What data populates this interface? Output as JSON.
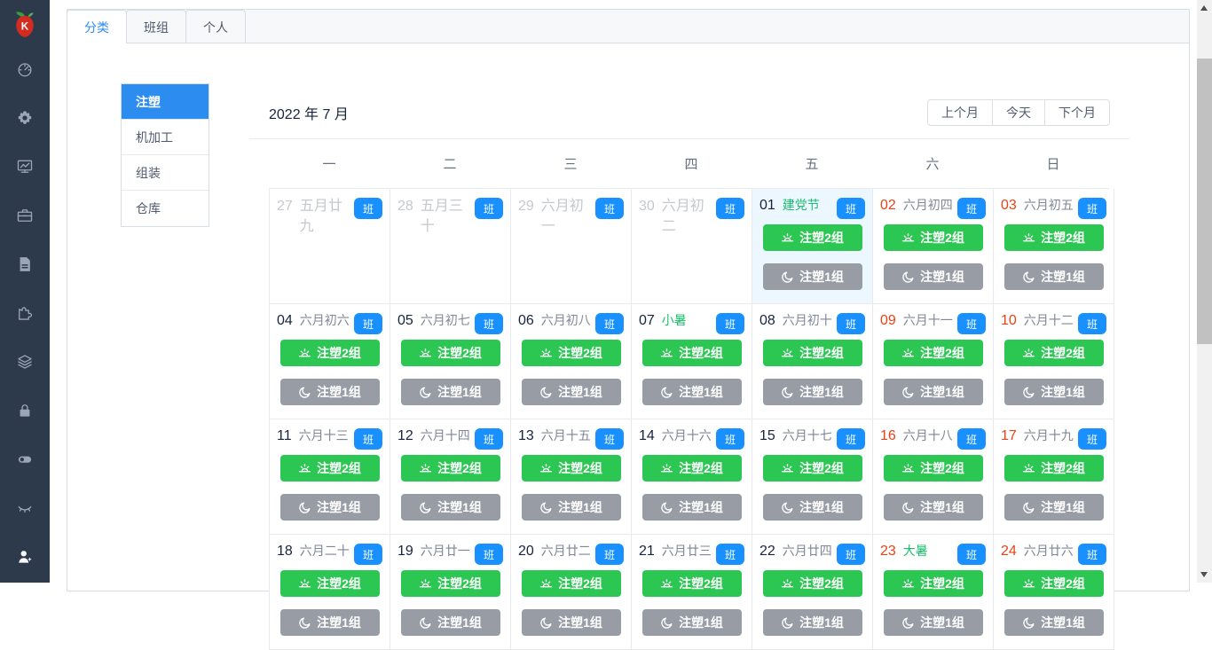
{
  "app": {
    "logo_letter": "K",
    "sidebar_icons": [
      "dashboard-icon",
      "gear-icon",
      "monitor-chart-icon",
      "briefcase-icon",
      "document-icon",
      "puzzle-icon",
      "layers-icon",
      "lock-icon",
      "toggle-icon",
      "eye-closed-icon",
      "user-icon"
    ]
  },
  "tabs": {
    "items": [
      {
        "name": "tab-category",
        "label": "分类",
        "active": true
      },
      {
        "name": "tab-group",
        "label": "班组",
        "active": false
      },
      {
        "name": "tab-personal",
        "label": "个人",
        "active": false
      }
    ]
  },
  "categories": {
    "items": [
      {
        "name": "category-injection",
        "label": "注塑",
        "selected": true
      },
      {
        "name": "category-machining",
        "label": "机加工",
        "selected": false
      },
      {
        "name": "category-assembly",
        "label": "组装",
        "selected": false
      },
      {
        "name": "category-warehouse",
        "label": "仓库",
        "selected": false
      }
    ]
  },
  "calendar": {
    "title": "2022 年 7 月",
    "nav": {
      "prev": "上个月",
      "today": "今天",
      "next": "下个月"
    },
    "weekdays": [
      "一",
      "二",
      "三",
      "四",
      "五",
      "六",
      "日"
    ],
    "badge_label": "班",
    "shift_day_label": "注塑2组",
    "shift_night_label": "注塑1组",
    "shift_day_icon": "sunrise-icon",
    "shift_night_icon": "moon-icon",
    "weeks": [
      [
        {
          "day": "27",
          "lunar": "五月廿九",
          "day_style": "dim",
          "lunar_style": "dim",
          "badge": true,
          "shifts": [],
          "highlight": false
        },
        {
          "day": "28",
          "lunar": "五月三十",
          "day_style": "dim",
          "lunar_style": "dim",
          "badge": true,
          "shifts": [],
          "highlight": false
        },
        {
          "day": "29",
          "lunar": "六月初一",
          "day_style": "dim",
          "lunar_style": "dim",
          "badge": true,
          "shifts": [],
          "highlight": false
        },
        {
          "day": "30",
          "lunar": "六月初二",
          "day_style": "dim",
          "lunar_style": "dim",
          "badge": true,
          "shifts": [],
          "highlight": false
        },
        {
          "day": "01",
          "lunar": "建党节",
          "day_style": "normal",
          "lunar_style": "green",
          "badge": true,
          "shifts": [
            "day",
            "night"
          ],
          "highlight": true
        },
        {
          "day": "02",
          "lunar": "六月初四",
          "day_style": "red",
          "lunar_style": "gray",
          "badge": true,
          "shifts": [
            "day",
            "night"
          ],
          "highlight": false
        },
        {
          "day": "03",
          "lunar": "六月初五",
          "day_style": "red",
          "lunar_style": "gray",
          "badge": true,
          "shifts": [
            "day",
            "night"
          ],
          "highlight": false
        }
      ],
      [
        {
          "day": "04",
          "lunar": "六月初六",
          "day_style": "normal",
          "lunar_style": "gray",
          "badge": true,
          "shifts": [
            "day",
            "night"
          ],
          "highlight": false
        },
        {
          "day": "05",
          "lunar": "六月初七",
          "day_style": "normal",
          "lunar_style": "gray",
          "badge": true,
          "shifts": [
            "day",
            "night"
          ],
          "highlight": false
        },
        {
          "day": "06",
          "lunar": "六月初八",
          "day_style": "normal",
          "lunar_style": "gray",
          "badge": true,
          "shifts": [
            "day",
            "night"
          ],
          "highlight": false
        },
        {
          "day": "07",
          "lunar": "小暑",
          "day_style": "normal",
          "lunar_style": "green",
          "badge": true,
          "shifts": [
            "day",
            "night"
          ],
          "highlight": false
        },
        {
          "day": "08",
          "lunar": "六月初十",
          "day_style": "normal",
          "lunar_style": "gray",
          "badge": true,
          "shifts": [
            "day",
            "night"
          ],
          "highlight": false
        },
        {
          "day": "09",
          "lunar": "六月十一",
          "day_style": "red",
          "lunar_style": "gray",
          "badge": true,
          "shifts": [
            "day",
            "night"
          ],
          "highlight": false
        },
        {
          "day": "10",
          "lunar": "六月十二",
          "day_style": "red",
          "lunar_style": "gray",
          "badge": true,
          "shifts": [
            "day",
            "night"
          ],
          "highlight": false
        }
      ],
      [
        {
          "day": "11",
          "lunar": "六月十三",
          "day_style": "normal",
          "lunar_style": "gray",
          "badge": true,
          "shifts": [
            "day",
            "night"
          ],
          "highlight": false
        },
        {
          "day": "12",
          "lunar": "六月十四",
          "day_style": "normal",
          "lunar_style": "gray",
          "badge": true,
          "shifts": [
            "day",
            "night"
          ],
          "highlight": false
        },
        {
          "day": "13",
          "lunar": "六月十五",
          "day_style": "normal",
          "lunar_style": "gray",
          "badge": true,
          "shifts": [
            "day",
            "night"
          ],
          "highlight": false
        },
        {
          "day": "14",
          "lunar": "六月十六",
          "day_style": "normal",
          "lunar_style": "gray",
          "badge": true,
          "shifts": [
            "day",
            "night"
          ],
          "highlight": false
        },
        {
          "day": "15",
          "lunar": "六月十七",
          "day_style": "normal",
          "lunar_style": "gray",
          "badge": true,
          "shifts": [
            "day",
            "night"
          ],
          "highlight": false
        },
        {
          "day": "16",
          "lunar": "六月十八",
          "day_style": "red",
          "lunar_style": "gray",
          "badge": true,
          "shifts": [
            "day",
            "night"
          ],
          "highlight": false
        },
        {
          "day": "17",
          "lunar": "六月十九",
          "day_style": "red",
          "lunar_style": "gray",
          "badge": true,
          "shifts": [
            "day",
            "night"
          ],
          "highlight": false
        }
      ],
      [
        {
          "day": "18",
          "lunar": "六月二十",
          "day_style": "normal",
          "lunar_style": "gray",
          "badge": true,
          "shifts": [
            "day",
            "night"
          ],
          "highlight": false
        },
        {
          "day": "19",
          "lunar": "六月廿一",
          "day_style": "normal",
          "lunar_style": "gray",
          "badge": true,
          "shifts": [
            "day",
            "night"
          ],
          "highlight": false
        },
        {
          "day": "20",
          "lunar": "六月廿二",
          "day_style": "normal",
          "lunar_style": "gray",
          "badge": true,
          "shifts": [
            "day",
            "night"
          ],
          "highlight": false
        },
        {
          "day": "21",
          "lunar": "六月廿三",
          "day_style": "normal",
          "lunar_style": "gray",
          "badge": true,
          "shifts": [
            "day",
            "night"
          ],
          "highlight": false
        },
        {
          "day": "22",
          "lunar": "六月廿四",
          "day_style": "normal",
          "lunar_style": "gray",
          "badge": true,
          "shifts": [
            "day",
            "night"
          ],
          "highlight": false
        },
        {
          "day": "23",
          "lunar": "大暑",
          "day_style": "red",
          "lunar_style": "green",
          "badge": true,
          "shifts": [
            "day",
            "night"
          ],
          "highlight": false
        },
        {
          "day": "24",
          "lunar": "六月廿六",
          "day_style": "red",
          "lunar_style": "gray",
          "badge": true,
          "shifts": [
            "day",
            "night"
          ],
          "highlight": false
        }
      ]
    ]
  },
  "colors": {
    "sidebar_bg": "#2d3a4b",
    "accent_blue": "#2d8cf0",
    "badge_blue": "#1890ff",
    "shift_day_green": "#2cc752",
    "shift_night_gray": "#989da5",
    "holiday_green": "#19be6b",
    "weekend_red": "#ed4014",
    "today_bg": "#edf7ff"
  }
}
